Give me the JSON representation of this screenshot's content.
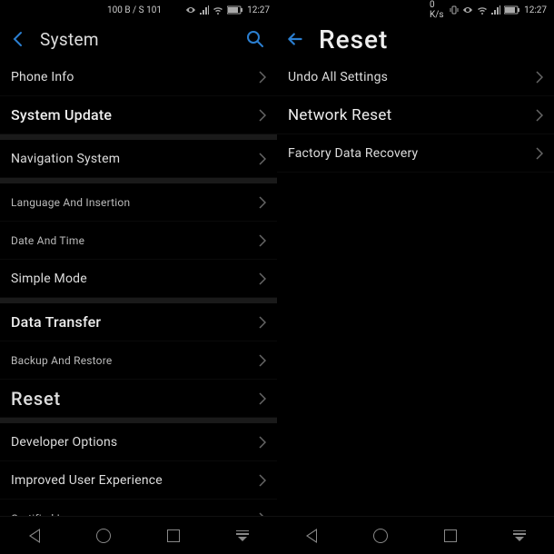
{
  "left": {
    "status": {
      "data_rate": "100 B / S 101",
      "time": "12:27"
    },
    "header": {
      "title": "System"
    },
    "groups": [
      {
        "items": [
          {
            "label": "Phone Info",
            "style": ""
          },
          {
            "label": "System Update",
            "style": "bold"
          }
        ]
      },
      {
        "items": [
          {
            "label": "Navigation System",
            "style": ""
          }
        ]
      },
      {
        "items": [
          {
            "label": "Language And Insertion",
            "style": "small"
          },
          {
            "label": "Date And Time",
            "style": "small"
          },
          {
            "label": "Simple Mode",
            "style": ""
          }
        ]
      },
      {
        "items": [
          {
            "label": "Data Transfer",
            "style": "bold"
          },
          {
            "label": "Backup And Restore",
            "style": "small"
          },
          {
            "label": "Reset",
            "style": "reset"
          }
        ]
      },
      {
        "items": [
          {
            "label": "Developer Options",
            "style": ""
          },
          {
            "label": "Improved User Experience",
            "style": ""
          },
          {
            "label": "Certified Logo",
            "style": "small"
          }
        ]
      }
    ]
  },
  "right": {
    "status": {
      "data_rate": "0 K/s",
      "time": "12:27"
    },
    "header": {
      "title": "Reset"
    },
    "items": [
      {
        "label": "Undo All Settings",
        "style": ""
      },
      {
        "label": "Network Reset",
        "style": "big-item"
      },
      {
        "label": "Factory Data Recovery",
        "style": ""
      }
    ]
  }
}
